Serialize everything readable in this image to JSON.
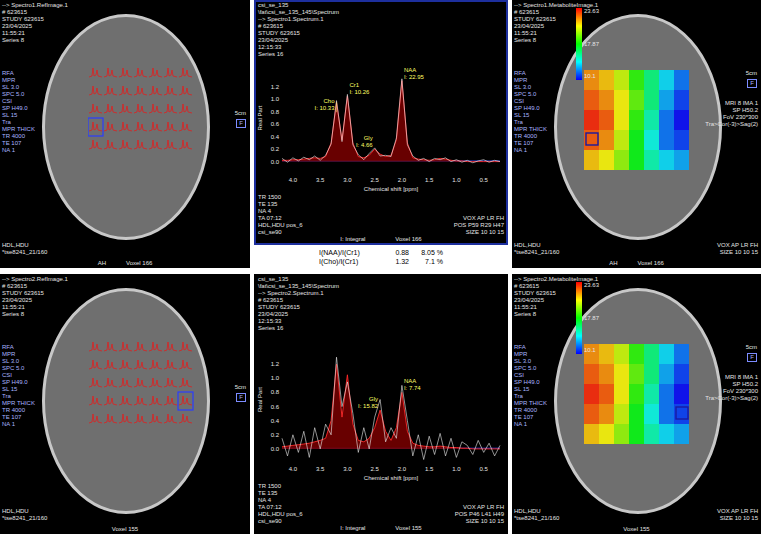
{
  "rows": [
    {
      "reference": {
        "header": [
          "--> Spectro1.RefImage.1",
          "# 623615",
          "STUDY 623615",
          "23/04/2025",
          "11:55:21",
          "Series 8"
        ],
        "params": [
          "RFA",
          "MPR",
          "SL 3.0",
          "SPC 5.0",
          "CSI",
          "SP H49.0",
          "SL 15",
          "Tra",
          "MPR THICK",
          "TR 4000",
          "TE 107",
          "NA 1"
        ],
        "footer": [
          "HDL,HDU",
          "*tse8241_21/160"
        ],
        "scale": "5cm",
        "orientation": "F",
        "voxel": "Voxel 166",
        "position_label": "AH",
        "grid": {
          "rows": 5,
          "cols": 7,
          "selected_row": 3,
          "selected_col": 0
        }
      },
      "spectrum": {
        "selected": true,
        "header": [
          "csi_se_135",
          "\\fat\\csi_se_135_145\\Spectrum",
          "--> Spectro1.Spectrum.1",
          "# 623615",
          "STUDY 623615",
          "23/04/2025",
          "12:15:33",
          "Series 16"
        ],
        "footer_left": [
          "TR 1500",
          "TE 135",
          "NA 4",
          "TA 07:12",
          "HDL,HDU pos_6",
          "csi_se90"
        ],
        "footer_right": [
          "VOX AP LR FH",
          "POS P59 R29 H47",
          "SIZE 10 10 15"
        ],
        "integral_note": "I: Integral",
        "voxel": "Voxel 166",
        "x_axis_label": "Chemical shift [ppm]",
        "y_axis_label": "Real Part",
        "x_ticks": [
          "4.0",
          "3.5",
          "3.0",
          "2.5",
          "2.0",
          "1.5",
          "1.0",
          "0.5"
        ],
        "y_ticks": [
          "1.2",
          "1.0",
          "0.8",
          "0.6",
          "0.4",
          "0.2",
          "0.0"
        ],
        "ppm": [
          4.2,
          4.1,
          4.0,
          3.9,
          3.8,
          3.7,
          3.6,
          3.5,
          3.4,
          3.3,
          3.2,
          3.1,
          3.0,
          2.9,
          2.8,
          2.7,
          2.6,
          2.5,
          2.4,
          2.3,
          2.2,
          2.1,
          2.0,
          1.9,
          1.8,
          1.7,
          1.6,
          1.5,
          1.4,
          1.3,
          1.2,
          1.1,
          1.0,
          0.9,
          0.8,
          0.7,
          0.6,
          0.5,
          0.4,
          0.3,
          0.2
        ],
        "raw": [
          0.05,
          -0.01,
          0.06,
          0.01,
          0.07,
          0.03,
          0.09,
          0.02,
          0.1,
          0.28,
          0.98,
          0.32,
          1.08,
          0.27,
          0.11,
          0.03,
          0.13,
          0.22,
          0.09,
          0.1,
          0.08,
          0.38,
          1.33,
          0.27,
          0.09,
          0.02,
          0.05,
          0.0,
          0.05,
          0.03,
          0.06,
          0.0,
          0.03,
          -0.01,
          0.02,
          -0.02,
          0.01,
          0.03,
          -0.01,
          0.02,
          0.0
        ],
        "fit": [
          0.02,
          0.02,
          0.03,
          0.03,
          0.04,
          0.05,
          0.06,
          0.05,
          0.08,
          0.3,
          0.95,
          0.35,
          1.05,
          0.3,
          0.08,
          0.06,
          0.1,
          0.2,
          0.12,
          0.08,
          0.1,
          0.35,
          1.3,
          0.3,
          0.06,
          0.04,
          0.03,
          0.02,
          0.03,
          0.05,
          0.04,
          0.02,
          0.01,
          0.01,
          0,
          0,
          0,
          0,
          0,
          0,
          0
        ],
        "peaks": [
          {
            "name": "NAA",
            "integral": "I: 22.95",
            "ppm": 2.0,
            "height": 1.3
          },
          {
            "name": "Cr1",
            "integral": "I: 10.26",
            "ppm": 3.0,
            "height": 1.05
          },
          {
            "name": "Cho",
            "integral": "I: 10.33",
            "ppm": 3.2,
            "height": 0.95
          },
          {
            "name": "Gly",
            "integral": "I: 4.66",
            "ppm": 2.5,
            "height": 0.2
          }
        ]
      },
      "ratios": [
        {
          "label": "I(NAA)/I(Cr1)",
          "value": "0.88",
          "error": "8.05 %"
        },
        {
          "label": "I(Cho)/I(Cr1)",
          "value": "1.32",
          "error": "7.1 %"
        }
      ],
      "metabolite_map": {
        "header": [
          "--> Spectro1.MetaboliteImage.1",
          "# 623615",
          "STUDY 623615",
          "23/04/2025",
          "11:55:21",
          "Series 8"
        ],
        "colorbar_labels": [
          "23.63",
          "17.87",
          "10.1"
        ],
        "range": [
          4.9,
          23.63
        ],
        "params": [
          "RFA",
          "MPR",
          "SL 3.0",
          "SPC 5.0",
          "CSI",
          "SP H49.0",
          "SL 15",
          "Tra",
          "MPR THICK",
          "TR 4000",
          "TE 107",
          "NA 1"
        ],
        "side": [
          "MRI 8 IMA 1",
          "SP H50.2",
          "FoV 230*300",
          "Tra>Cor(-3)>Sag(2)"
        ],
        "footer": [
          "HDL,HDU",
          "*tse8241_21/160"
        ],
        "footer_right": [
          "VOX AP LR FH",
          "SIZE 10 10 15"
        ],
        "scale": "5cm",
        "orientation": "F",
        "voxel": "Voxel 166",
        "position_label": "AH",
        "values": [
          [
            21,
            20,
            18,
            15,
            12,
            9,
            7
          ],
          [
            22,
            21,
            19,
            16,
            12,
            8,
            6
          ],
          [
            23,
            22,
            19,
            15,
            11,
            7,
            5
          ],
          [
            22,
            21,
            18,
            14,
            10,
            7,
            6
          ],
          [
            20,
            19,
            17,
            14,
            11,
            9,
            8
          ]
        ],
        "selected_row": 3,
        "selected_col": 0
      }
    },
    {
      "reference": {
        "header": [
          "--> Spectro2.RefImage.1",
          "# 623615",
          "STUDY 623615",
          "23/04/2025",
          "11:55:21",
          "Series 8"
        ],
        "params": [
          "RFA",
          "MPR",
          "SL 3.0",
          "SPC 5.0",
          "CSI",
          "SP H49.0",
          "SL 15",
          "Tra",
          "MPR THICK",
          "TR 4000",
          "TE 107",
          "NA 1"
        ],
        "footer": [
          "HDL,HDU",
          "*tse8241_21/160"
        ],
        "scale": "5cm",
        "orientation": "F",
        "voxel": "Voxel 155",
        "grid": {
          "rows": 5,
          "cols": 7,
          "selected_row": 3,
          "selected_col": 6
        }
      },
      "spectrum": {
        "selected": false,
        "header": [
          "csi_se_135",
          "\\fat\\csi_se_135_145\\Spectrum",
          "--> Spectro2.Spectrum.1",
          "# 623615",
          "STUDY 623615",
          "23/04/2025",
          "12:15:33",
          "Series 16"
        ],
        "footer_left": [
          "TR 1500",
          "TE 135",
          "NA 4",
          "TA 07:12",
          "HDL,HDU pos_6",
          "csi_se90"
        ],
        "footer_right": [
          "VOX AP LR FH",
          "POS P46 L41 H49",
          "SIZE 10 10 15"
        ],
        "integral_note": "I: Integral",
        "voxel": "Voxel 155",
        "x_axis_label": "Chemical shift [ppm]",
        "y_axis_label": "Real Part",
        "x_ticks": [
          "4.0",
          "3.5",
          "3.0",
          "2.5",
          "2.0",
          "1.5",
          "1.0",
          "0.5"
        ],
        "y_ticks": [
          "1.2",
          "1.0",
          "0.8",
          "0.6",
          "0.4",
          "0.2",
          "0.0"
        ],
        "ppm": [
          4.2,
          4.1,
          4.0,
          3.9,
          3.8,
          3.7,
          3.6,
          3.5,
          3.4,
          3.3,
          3.2,
          3.1,
          3.0,
          2.9,
          2.8,
          2.7,
          2.6,
          2.5,
          2.4,
          2.3,
          2.2,
          2.1,
          2.0,
          1.9,
          1.8,
          1.7,
          1.6,
          1.5,
          1.4,
          1.3,
          1.2,
          1.1,
          1.0,
          0.9,
          0.8,
          0.7,
          0.6,
          0.5,
          0.4,
          0.3,
          0.2
        ],
        "raw": [
          0.15,
          -0.1,
          0.2,
          -0.05,
          0.25,
          -0.12,
          0.3,
          0.0,
          0.35,
          0.2,
          1.3,
          0.6,
          0.95,
          0.5,
          -0.05,
          0.3,
          0.0,
          0.45,
          0.7,
          0.1,
          0.3,
          0.15,
          0.9,
          0.4,
          -0.1,
          0.2,
          -0.15,
          0.18,
          -0.08,
          0.22,
          -0.1,
          0.15,
          -0.12,
          0.1,
          0.05,
          -0.08,
          0.12,
          -0.05,
          0.08,
          -0.1,
          0.05
        ],
        "fit": [
          0.03,
          0.04,
          0.05,
          0.06,
          0.07,
          0.08,
          0.1,
          0.12,
          0.15,
          0.4,
          1.2,
          0.45,
          1.05,
          0.35,
          0.12,
          0.1,
          0.15,
          0.3,
          0.55,
          0.25,
          0.12,
          0.3,
          0.8,
          0.25,
          0.08,
          0.05,
          0.04,
          0.03,
          0.03,
          0.04,
          0.03,
          0.02,
          0.02,
          0.01,
          0.01,
          0,
          0,
          0,
          0,
          0,
          0
        ],
        "peaks": [
          {
            "name": "NAA",
            "integral": "I: 7.74",
            "ppm": 2.0,
            "height": 0.8
          },
          {
            "name": "Gly",
            "integral": "I: 15.82",
            "ppm": 2.4,
            "height": 0.55
          }
        ]
      },
      "ratios": [],
      "metabolite_map": {
        "header": [
          "--> Spectro2.MetaboliteImage.1",
          "# 623615",
          "STUDY 623615",
          "23/04/2025",
          "11:55:21",
          "Series 8"
        ],
        "colorbar_labels": [
          "23.63",
          "17.87",
          "10.1"
        ],
        "range": [
          4.9,
          23.63
        ],
        "params": [
          "RFA",
          "MPR",
          "SL 3.0",
          "SPC 5.0",
          "CSI",
          "SP H49.0",
          "SL 15",
          "Tra",
          "MPR THICK",
          "TR 4000",
          "TE 107",
          "NA 1"
        ],
        "side": [
          "MRI 8 IMA 1",
          "SP H50.2",
          "FoV 230*300",
          "Tra>Cor(-3)>Sag(2)"
        ],
        "footer": [
          "HDL,HDU",
          "*tse8241_21/160"
        ],
        "footer_right": [
          "VOX AP LR FH",
          "SIZE 10 10 15"
        ],
        "scale": "5cm",
        "orientation": "F",
        "voxel": "Voxel 155",
        "values": [
          [
            21,
            20,
            18,
            15,
            12,
            9,
            7
          ],
          [
            22,
            21,
            19,
            16,
            12,
            8,
            6
          ],
          [
            23,
            22,
            19,
            15,
            11,
            7,
            5
          ],
          [
            22,
            21,
            18,
            14,
            10,
            7,
            6
          ],
          [
            20,
            19,
            17,
            14,
            11,
            9,
            8
          ]
        ],
        "selected_row": 3,
        "selected_col": 6
      }
    }
  ]
}
